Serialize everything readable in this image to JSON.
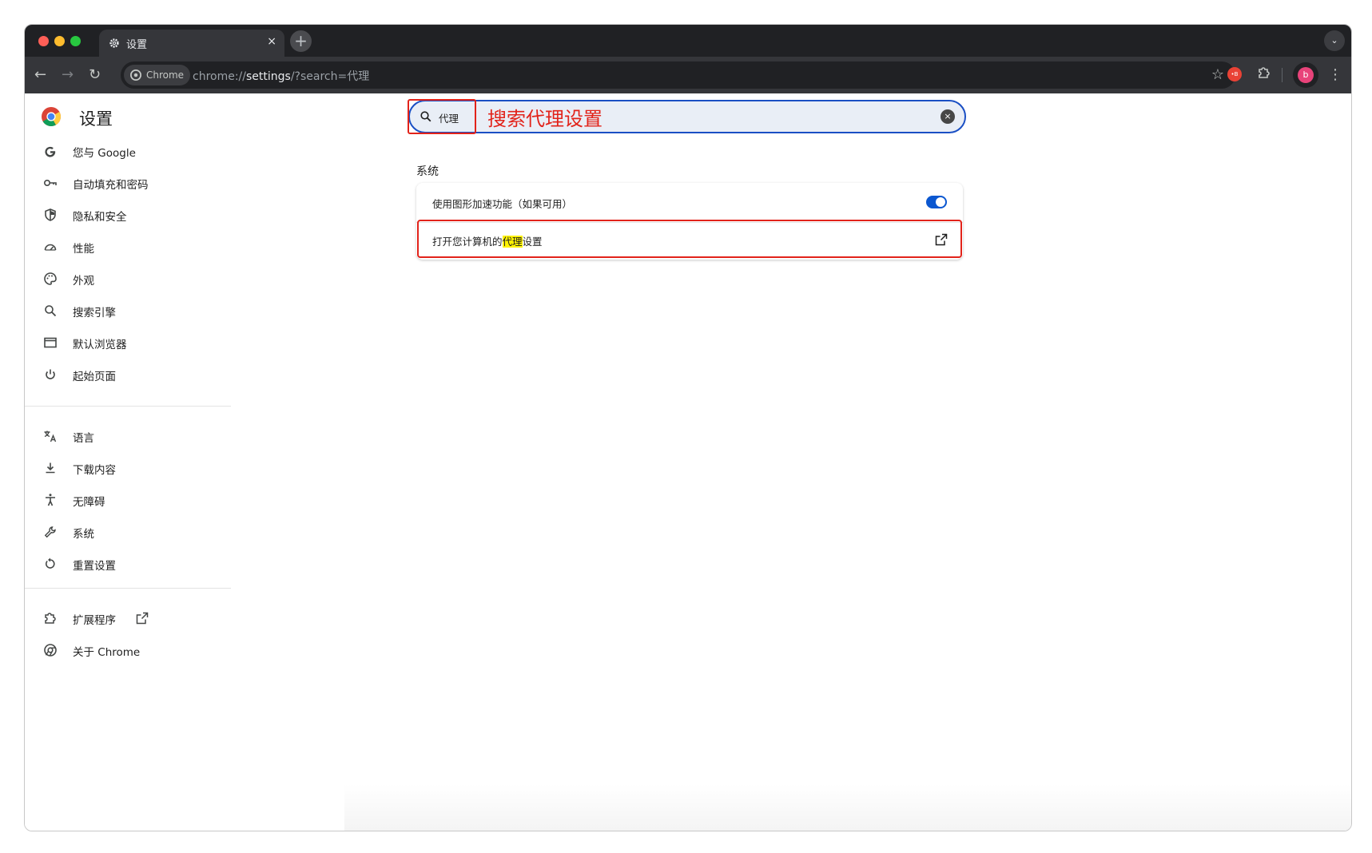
{
  "window": {
    "tab_title": "设置",
    "tab_close": "×",
    "new_tab": "+",
    "tab_menu": "⌄"
  },
  "toolbar": {
    "back": "←",
    "forward": "→",
    "reload": "↻",
    "chip_label": "Chrome",
    "url_prefix": "chrome://",
    "url_host": "settings",
    "url_suffix": "/?search=代理",
    "bookmark": "☆",
    "ext_badge": "•B",
    "avatar_letter": "b",
    "menu": "⋮"
  },
  "settings": {
    "title": "设置",
    "sidebar": {
      "group1": [
        {
          "label": "您与 Google",
          "icon": "google-icon"
        },
        {
          "label": "自动填充和密码",
          "icon": "key-icon"
        },
        {
          "label": "隐私和安全",
          "icon": "shield-icon"
        },
        {
          "label": "性能",
          "icon": "speedometer-icon"
        },
        {
          "label": "外观",
          "icon": "palette-icon"
        },
        {
          "label": "搜索引擎",
          "icon": "search-icon"
        },
        {
          "label": "默认浏览器",
          "icon": "browser-window-icon"
        },
        {
          "label": "起始页面",
          "icon": "power-icon"
        }
      ],
      "group2": [
        {
          "label": "语言",
          "icon": "translate-icon"
        },
        {
          "label": "下载内容",
          "icon": "download-icon"
        },
        {
          "label": "无障碍",
          "icon": "accessibility-icon"
        },
        {
          "label": "系统",
          "icon": "wrench-icon"
        },
        {
          "label": "重置设置",
          "icon": "reset-icon"
        }
      ],
      "group3": [
        {
          "label": "扩展程序",
          "icon": "puzzle-icon"
        },
        {
          "label": "关于 Chrome",
          "icon": "chrome-icon"
        }
      ]
    },
    "search": {
      "value": "代理",
      "clear": "×"
    },
    "annotation": "搜索代理设置",
    "section_title": "系统",
    "rows": {
      "graphics_acceleration": "使用图形加速功能（如果可用）",
      "proxy_before": "打开您计算机的",
      "proxy_highlight": "代理",
      "proxy_after": "设置"
    },
    "colors": {
      "accent": "#0b57d0",
      "annotation_red": "#e2231a",
      "highlight": "#fff200"
    }
  }
}
